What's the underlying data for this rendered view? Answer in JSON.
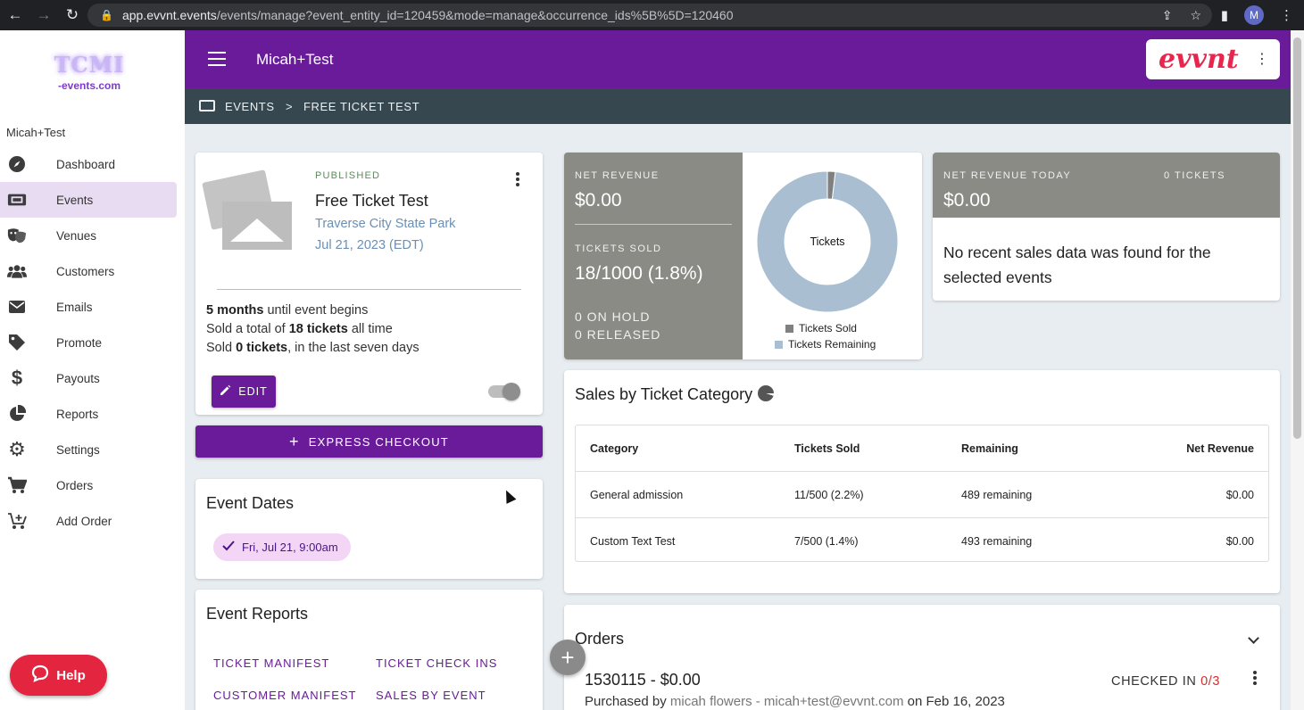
{
  "browser": {
    "url_host": "app.evvnt.events",
    "url_path": "/events/manage?event_entity_id=120459&mode=manage&occurrence_ids%5B%5D=120460",
    "profile_initial": "M"
  },
  "sidebar": {
    "logo_main": "TCMI",
    "logo_sub": "-events.com",
    "org_name": "Micah+Test",
    "items": [
      {
        "label": "Dashboard",
        "icon": "compass-icon"
      },
      {
        "label": "Events",
        "icon": "ticket-icon"
      },
      {
        "label": "Venues",
        "icon": "theater-masks-icon"
      },
      {
        "label": "Customers",
        "icon": "users-icon"
      },
      {
        "label": "Emails",
        "icon": "envelope-icon"
      },
      {
        "label": "Promote",
        "icon": "tag-icon"
      },
      {
        "label": "Payouts",
        "icon": "dollar-icon"
      },
      {
        "label": "Reports",
        "icon": "pie-chart-icon"
      },
      {
        "label": "Settings",
        "icon": "gear-icon"
      },
      {
        "label": "Orders",
        "icon": "cart-icon"
      },
      {
        "label": "Add Order",
        "icon": "cart-plus-icon"
      }
    ],
    "help_label": "Help"
  },
  "topbar": {
    "title": "Micah+Test",
    "brand": "evvnt"
  },
  "breadcrumb": {
    "root": "EVENTS",
    "separator": ">",
    "current": "FREE TICKET TEST"
  },
  "event": {
    "status": "PUBLISHED",
    "title": "Free Ticket Test",
    "venue": "Traverse City State Park",
    "date": "Jul 21, 2023 (EDT)",
    "stats": [
      {
        "bold": "5 months",
        "text": " until event begins",
        "prefix": ""
      },
      {
        "prefix": "Sold a total of ",
        "bold": "18 tickets",
        "text": " all time"
      },
      {
        "prefix": "Sold ",
        "bold": "0 tickets",
        "text": ", in the last seven days"
      }
    ],
    "edit_label": "EDIT",
    "published_toggle": true
  },
  "express_checkout_label": "EXPRESS CHECKOUT",
  "event_dates": {
    "title": "Event Dates",
    "chips": [
      "Fri, Jul 21, 9:00am"
    ]
  },
  "event_reports": {
    "title": "Event Reports",
    "links": [
      "TICKET MANIFEST",
      "TICKET CHECK INS",
      "CUSTOMER MANIFEST",
      "SALES BY EVENT"
    ]
  },
  "revenue": {
    "net_revenue_label": "NET REVENUE",
    "net_revenue_value": "$0.00",
    "tickets_sold_label": "TICKETS SOLD",
    "tickets_sold_count": "18",
    "tickets_sold_rest": "/1000 (1.8%)",
    "on_hold": "0 ON HOLD",
    "released": "0 RELEASED"
  },
  "chart_data": {
    "type": "pie",
    "center_label": "Tickets",
    "categories": [
      "Tickets Sold",
      "Tickets Remaining"
    ],
    "values": [
      18,
      982
    ],
    "colors": [
      "#808080",
      "#a9bfd1"
    ],
    "legend_position": "bottom"
  },
  "today": {
    "label": "NET REVENUE TODAY",
    "tickets_label": "0 TICKETS",
    "value": "$0.00",
    "message": "No recent sales data was found for the selected events"
  },
  "sales_by_category": {
    "title": "Sales by Ticket Category",
    "columns": [
      "Category",
      "Tickets Sold",
      "Remaining",
      "Net Revenue"
    ],
    "rows": [
      [
        "General admission",
        "11/500 (2.2%)",
        "489 remaining",
        "$0.00"
      ],
      [
        "Custom Text Test",
        "7/500 (1.4%)",
        "493 remaining",
        "$0.00"
      ]
    ]
  },
  "orders": {
    "title": "Orders",
    "items": [
      {
        "number": "1530115",
        "amount": " - $0.00",
        "purchased_prefix": "Purchased by ",
        "purchaser": "micah flowers - micah+test@evvnt.com",
        "date_suffix": " on Feb 16, 2023",
        "checked_in_label": "CHECKED IN ",
        "checked_in_value": "0/3"
      }
    ]
  },
  "colors": {
    "primary": "#6a1b9a",
    "breadcrumb_bg": "#37474f",
    "stat_panel": "#8b8b85",
    "help": "#e3253f",
    "brand_red": "#e8264d"
  }
}
